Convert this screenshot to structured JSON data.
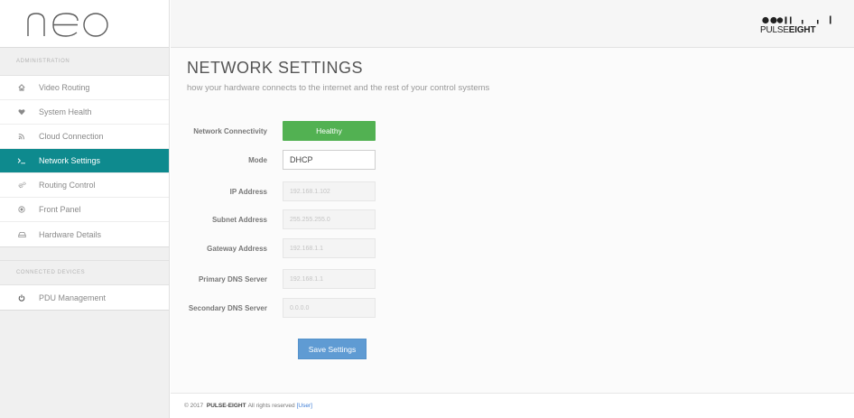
{
  "app": {
    "logo_text": "neo"
  },
  "sidebar": {
    "section_admin": "ADMINISTRATION",
    "items": [
      {
        "label": "Video Routing",
        "icon": "home-icon"
      },
      {
        "label": "System Health",
        "icon": "heart-icon"
      },
      {
        "label": "Cloud Connection",
        "icon": "rss-icon"
      },
      {
        "label": "Network Settings",
        "icon": "terminal-icon",
        "active": true
      },
      {
        "label": "Routing Control",
        "icon": "cogs-icon"
      },
      {
        "label": "Front Panel",
        "icon": "dot-circle-icon"
      },
      {
        "label": "Hardware Details",
        "icon": "hdd-icon"
      }
    ],
    "section_devices": "CONNECTED DEVICES",
    "device_items": [
      {
        "label": "PDU Management",
        "icon": "power-icon"
      }
    ]
  },
  "header": {
    "brand_prefix": "PULSE",
    "brand_suffix": "EIGHT"
  },
  "main": {
    "title": "NETWORK SETTINGS",
    "subtitle": "how your hardware connects to the internet and the rest of your control systems",
    "form": {
      "connectivity_label": "Network Connectivity",
      "connectivity_status": "Healthy",
      "mode_label": "Mode",
      "mode_value": "DHCP",
      "ip_label": "IP Address",
      "ip_value": "192.168.1.102",
      "subnet_label": "Subnet Address",
      "subnet_value": "255.255.255.0",
      "gateway_label": "Gateway Address",
      "gateway_value": "192.168.1.1",
      "primary_dns_label": "Primary DNS Server",
      "primary_dns_value": "192.168.1.1",
      "secondary_dns_label": "Secondary DNS Server",
      "secondary_dns_value": "0.0.0.0"
    },
    "save_label": "Save Settings"
  },
  "footer": {
    "copyright": "© 2017",
    "company": "PULSE-EIGHT",
    "rights": "All rights reserved",
    "user_link": "[User]"
  },
  "colors": {
    "active_nav": "#0e8a8e",
    "healthy": "#52b152",
    "save_button": "#5f9bd3"
  }
}
